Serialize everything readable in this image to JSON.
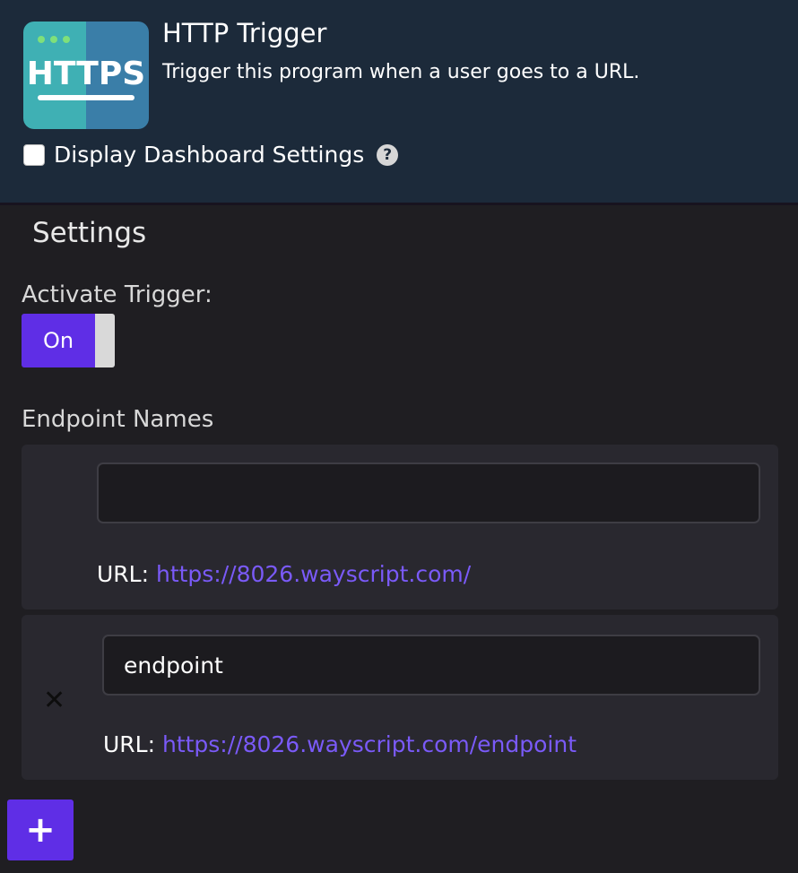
{
  "header": {
    "logo_text": "HTTPS",
    "title": "HTTP Trigger",
    "subtitle": "Trigger this program when a user goes to a URL.",
    "dashboard_settings_label": "Display Dashboard Settings",
    "dashboard_settings_checked": false,
    "help_icon": "?"
  },
  "settings": {
    "heading": "Settings",
    "activate_label": "Activate Trigger:",
    "toggle_label": "On",
    "toggle_state": "on",
    "endpoints_label": "Endpoint Names",
    "endpoints": [
      {
        "value": "",
        "url_prefix": "URL: ",
        "url": "https://8026.wayscript.com/",
        "removable": false
      },
      {
        "value": "endpoint",
        "url_prefix": "URL: ",
        "url": "https://8026.wayscript.com/endpoint",
        "removable": true,
        "remove_icon": "✕"
      }
    ],
    "add_button_label": "+"
  },
  "colors": {
    "header_bg": "#1c2a3a",
    "page_bg": "#1f1e22",
    "card_bg": "#29282f",
    "accent": "#5f2ee6",
    "link": "#7a5af8",
    "logo_left": "#3fb0b4",
    "logo_right": "#3a7ea8"
  }
}
